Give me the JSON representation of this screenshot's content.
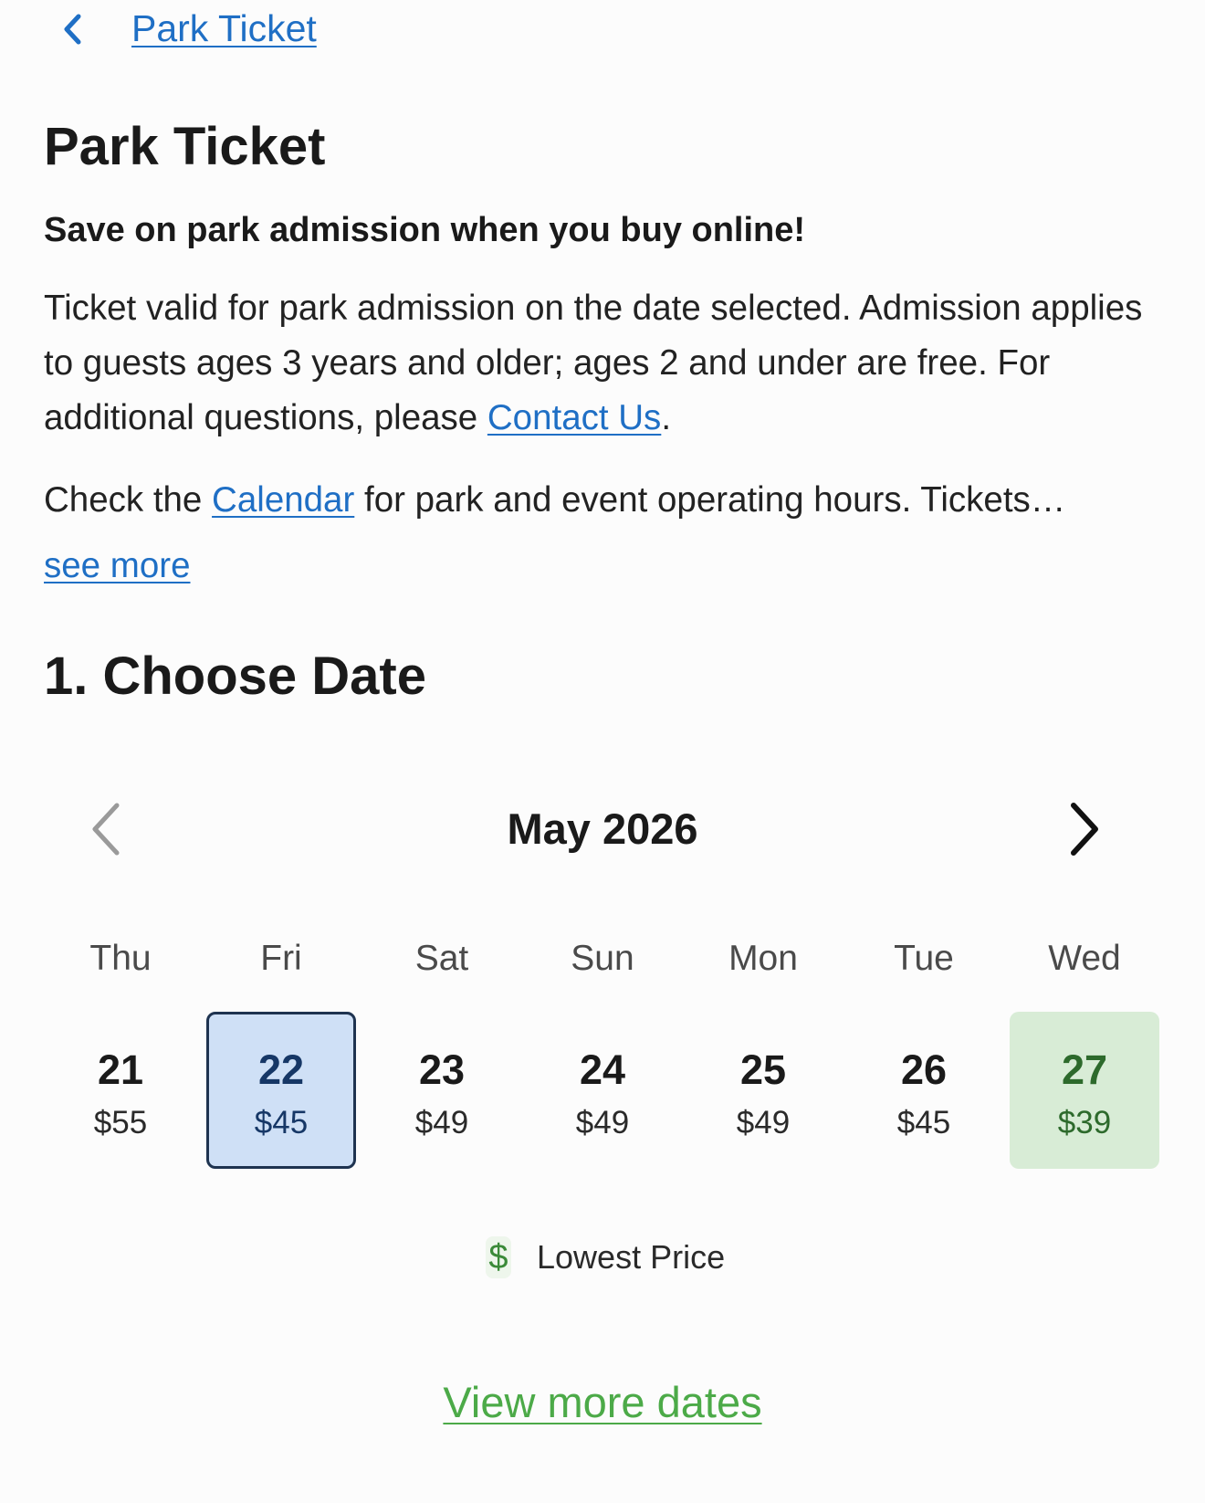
{
  "header": {
    "back_icon": "chevron-left-icon",
    "breadcrumb": "Park Ticket"
  },
  "product": {
    "title": "Park Ticket",
    "subtitle": "Save on park admission when you buy online!",
    "description_text": "Ticket valid for park admission on the date selected. Admission applies to guests ages 3 years and older; ages 2 and under are free. For additional questions, please ",
    "contact_link": "Contact Us",
    "description_end": ".",
    "calendar_text_before": "Check the ",
    "calendar_link": "Calendar",
    "calendar_text_after": " for park and event operating hours. Tickets…",
    "see_more": "see more"
  },
  "section": {
    "title": "1. Choose Date"
  },
  "calendar": {
    "month_label": "May 2026",
    "prev_icon": "chevron-left-icon",
    "next_icon": "chevron-right-icon",
    "weekdays": [
      "Thu",
      "Fri",
      "Sat",
      "Sun",
      "Mon",
      "Tue",
      "Wed"
    ],
    "days": [
      {
        "day": "21",
        "price": "$55",
        "state": "normal"
      },
      {
        "day": "22",
        "price": "$45",
        "state": "selected"
      },
      {
        "day": "23",
        "price": "$49",
        "state": "normal"
      },
      {
        "day": "24",
        "price": "$49",
        "state": "normal"
      },
      {
        "day": "25",
        "price": "$49",
        "state": "normal"
      },
      {
        "day": "26",
        "price": "$45",
        "state": "normal"
      },
      {
        "day": "27",
        "price": "$39",
        "state": "lowest"
      }
    ],
    "colors": {
      "selected_bg": "#cfe0f6",
      "selected_border": "#1e3350",
      "lowest_bg": "#d8ecd6",
      "lowest_text": "#2d6a2c"
    }
  },
  "legend": {
    "icon": "dollar-icon",
    "symbol": "$",
    "label": "Lowest Price"
  },
  "footer": {
    "view_more": "View more dates"
  },
  "colors": {
    "link": "#1f6fc5",
    "accent_green": "#4caa48"
  }
}
